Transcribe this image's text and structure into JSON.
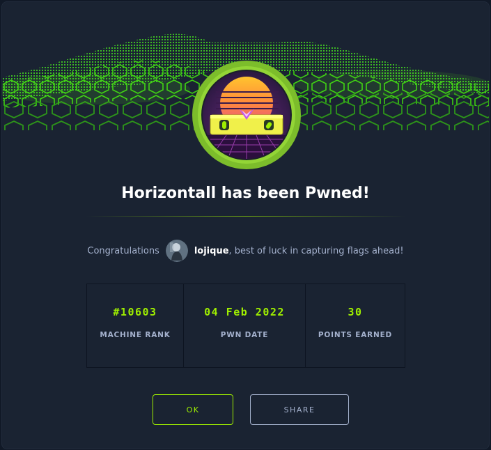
{
  "dialog": {
    "title": "Horizontall has been Pwned!",
    "congrats_prefix": "Congratulations",
    "username": "lojique",
    "congrats_suffix": ", best of luck in capturing flags ahead!"
  },
  "stats": [
    {
      "value": "#10603",
      "label": "MACHINE RANK"
    },
    {
      "value": "04 Feb 2022",
      "label": "PWN DATE"
    },
    {
      "value": "30",
      "label": "POINTS EARNED"
    }
  ],
  "buttons": {
    "ok": "OK",
    "share": "SHARE"
  },
  "colors": {
    "accent": "#9fef00",
    "background": "#1a2332",
    "text_muted": "#a4b1cd"
  }
}
